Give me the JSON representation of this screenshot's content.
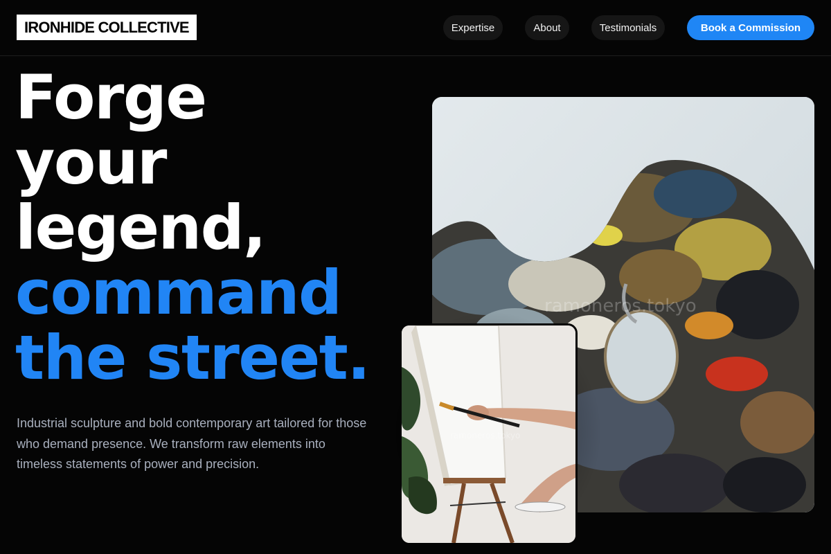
{
  "brand": {
    "name": "IRONHIDE COLLECTIVE"
  },
  "nav": {
    "items": [
      {
        "label": "Expertise"
      },
      {
        "label": "About"
      },
      {
        "label": "Testimonials"
      }
    ],
    "cta_label": "Book a Commission"
  },
  "hero": {
    "headline_lines": [
      "Forge",
      "your",
      "legend,",
      "command",
      "the street."
    ],
    "lede": "Industrial sculpture and bold contemporary art tailored for those who demand presence. We transform raw elements into timeless statements of power and precision.",
    "images": [
      {
        "icon": "paint-palette-photo",
        "watermark": "ramoneros.tokyo"
      },
      {
        "icon": "painter-at-easel-photo",
        "watermark": "ramoneros.tokyo"
      }
    ]
  },
  "colors": {
    "background": "#050505",
    "accent": "#1f86f5",
    "headline_blue": "#2185f5",
    "body_text": "#a9b0be"
  }
}
